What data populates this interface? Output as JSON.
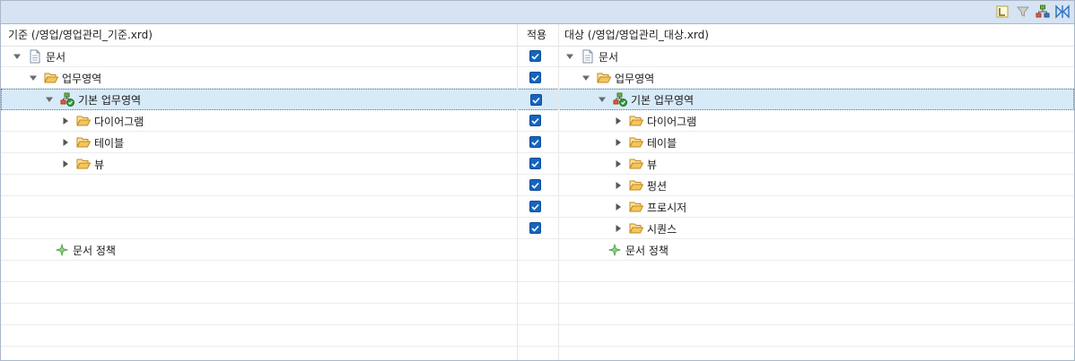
{
  "toolbar": {
    "buttons": [
      {
        "name": "layout-toggle-icon"
      },
      {
        "name": "filter-icon"
      },
      {
        "name": "hierarchy-icon"
      },
      {
        "name": "compare-arrows-icon"
      }
    ]
  },
  "columns": {
    "base": "기준 (/영업/영업관리_기준.xrd)",
    "apply": "적용",
    "target": "대상 (/영업/영업관리_대상.xrd)"
  },
  "left_tree": [
    {
      "label": "문서",
      "icon": "document-icon",
      "twisty": "expanded",
      "level": 0,
      "row": 0
    },
    {
      "label": "업무영역",
      "icon": "folder-open-icon",
      "twisty": "expanded",
      "level": 1,
      "row": 1
    },
    {
      "label": "기본 업무영역",
      "icon": "business-area-icon",
      "twisty": "expanded",
      "level": 2,
      "row": 2
    },
    {
      "label": "다이어그램",
      "icon": "folder-open-icon",
      "twisty": "collapsed",
      "level": 3,
      "row": 3
    },
    {
      "label": "테이블",
      "icon": "folder-open-icon",
      "twisty": "collapsed",
      "level": 3,
      "row": 4
    },
    {
      "label": "뷰",
      "icon": "folder-open-icon",
      "twisty": "collapsed",
      "level": 3,
      "row": 5
    },
    {
      "label": "문서 정책",
      "icon": "policy-icon",
      "twisty": "none",
      "level": 2,
      "row": 9
    }
  ],
  "right_tree": [
    {
      "label": "문서",
      "icon": "document-icon",
      "twisty": "expanded",
      "level": 0,
      "row": 0
    },
    {
      "label": "업무영역",
      "icon": "folder-open-icon",
      "twisty": "expanded",
      "level": 1,
      "row": 1
    },
    {
      "label": "기본 업무영역",
      "icon": "business-area-icon",
      "twisty": "expanded",
      "level": 2,
      "row": 2
    },
    {
      "label": "다이어그램",
      "icon": "folder-open-icon",
      "twisty": "collapsed",
      "level": 3,
      "row": 3
    },
    {
      "label": "테이블",
      "icon": "folder-open-icon",
      "twisty": "collapsed",
      "level": 3,
      "row": 4
    },
    {
      "label": "뷰",
      "icon": "folder-open-icon",
      "twisty": "collapsed",
      "level": 3,
      "row": 5
    },
    {
      "label": "펑션",
      "icon": "folder-open-icon",
      "twisty": "collapsed",
      "level": 3,
      "row": 6
    },
    {
      "label": "프로시저",
      "icon": "folder-open-icon",
      "twisty": "collapsed",
      "level": 3,
      "row": 7
    },
    {
      "label": "시퀀스",
      "icon": "folder-open-icon",
      "twisty": "collapsed",
      "level": 3,
      "row": 8
    },
    {
      "label": "문서 정책",
      "icon": "policy-icon",
      "twisty": "none",
      "level": 2,
      "row": 9
    }
  ],
  "apply_checked_rows": [
    0,
    1,
    2,
    3,
    4,
    5,
    6,
    7,
    8
  ],
  "selected_row": 2,
  "total_rows": 15,
  "colors": {
    "toolbar_bg": "#d5e3f2",
    "selection_bg": "#d7eaf8",
    "checkbox": "#1565c0",
    "folder": "#f4c55b"
  }
}
